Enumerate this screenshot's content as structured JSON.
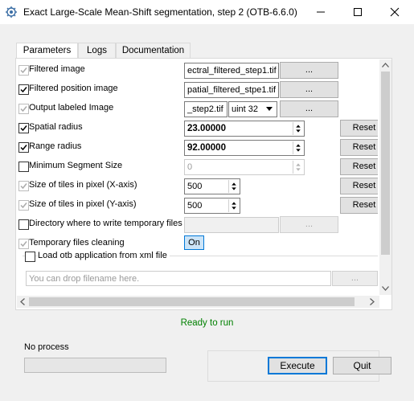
{
  "window": {
    "title": "Exact Large-Scale Mean-Shift segmentation, step 2 (OTB-6.6.0)",
    "minimize_glyph": "—",
    "maximize_glyph": "☐",
    "close_glyph": "✕"
  },
  "tabs": [
    {
      "label": "Parameters",
      "active": true
    },
    {
      "label": "Logs",
      "active": false
    },
    {
      "label": "Documentation",
      "active": false
    }
  ],
  "params": {
    "filtered_image": {
      "label": "Filtered image",
      "checked": true,
      "enabled": false,
      "value": "ectral_filtered_step1.tif",
      "browse": "..."
    },
    "filtered_position": {
      "label": "Filtered position image",
      "checked": true,
      "enabled": true,
      "value": "patial_filtered_stpe1.tif",
      "browse": "..."
    },
    "output_labeled": {
      "label": "Output labeled Image",
      "checked": true,
      "enabled": false,
      "value": "_step2.tif",
      "type": "uint 32",
      "browse": "..."
    },
    "spatial_radius": {
      "label": "Spatial radius",
      "checked": true,
      "value": "23.00000",
      "reset": "Reset"
    },
    "range_radius": {
      "label": "Range radius",
      "checked": true,
      "value": "92.00000",
      "reset": "Reset"
    },
    "min_segment_size": {
      "label": "Minimum Segment Size",
      "checked": false,
      "value": "0",
      "reset": "Reset"
    },
    "tile_x": {
      "label": "Size of tiles in pixel (X-axis)",
      "checked": true,
      "value": "500",
      "reset": "Reset"
    },
    "tile_y": {
      "label": "Size of tiles in pixel (Y-axis)",
      "checked": true,
      "value": "500",
      "reset": "Reset"
    },
    "temp_dir": {
      "label": "Directory where to write temporary files",
      "checked": false,
      "value": "",
      "browse": "..."
    },
    "temp_cleaning": {
      "label": "Temporary files cleaning",
      "checked": true,
      "toggle": "On"
    }
  },
  "xml": {
    "label": "Load otb application from xml file",
    "checked": false,
    "placeholder": "You can drop filename here.",
    "browse": "..."
  },
  "status": {
    "text": "Ready to run",
    "color": "#008000"
  },
  "process": {
    "label": "No process",
    "progress": 0
  },
  "actions": {
    "execute": "Execute",
    "quit": "Quit"
  },
  "colors": {
    "accent": "#0078d7",
    "link_blue": "#1565c0"
  }
}
